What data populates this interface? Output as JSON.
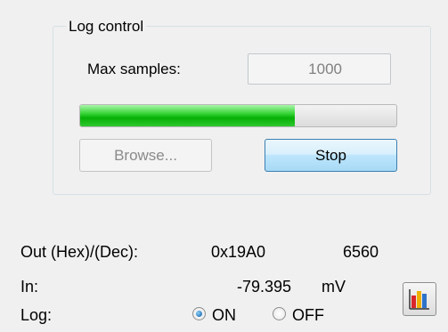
{
  "log_control": {
    "title": "Log control",
    "max_samples_label": "Max samples:",
    "max_samples_value": "1000",
    "progress_percent": 68,
    "browse_label": "Browse...",
    "stop_label": "Stop"
  },
  "status": {
    "out_label": "Out (Hex)/(Dec):",
    "out_hex": "0x19A0",
    "out_dec": "6560",
    "in_label": "In:",
    "in_value": "-79.395",
    "in_unit": "mV",
    "log_label": "Log:",
    "log_on": "ON",
    "log_off": "OFF",
    "log_selected": "ON"
  },
  "toolbar": {
    "chart_button_icon": "bar-chart-icon"
  }
}
